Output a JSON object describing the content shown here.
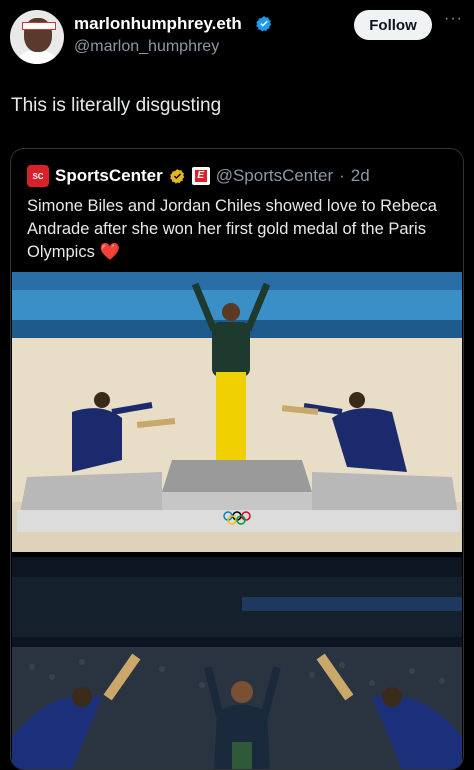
{
  "author": {
    "display_name": "marlonhumphrey.eth",
    "handle": "@marlon_humphrey",
    "verified_color": "#1d9bf0"
  },
  "follow_label": "Follow",
  "more_label": "···",
  "tweet_text": "This is literally disgusting",
  "quoted": {
    "display_name": "SportsCenter",
    "logo_text": "SC",
    "affiliate_letter": "E",
    "handle": "@SportsCenter",
    "dot": "·",
    "age": "2d",
    "text": "Simone Biles and Jordan Chiles showed love to Rebeca Andrade after she won her first gold medal of the Paris Olympics",
    "emoji": "❤️",
    "gold_check_color": "#e2b719"
  }
}
